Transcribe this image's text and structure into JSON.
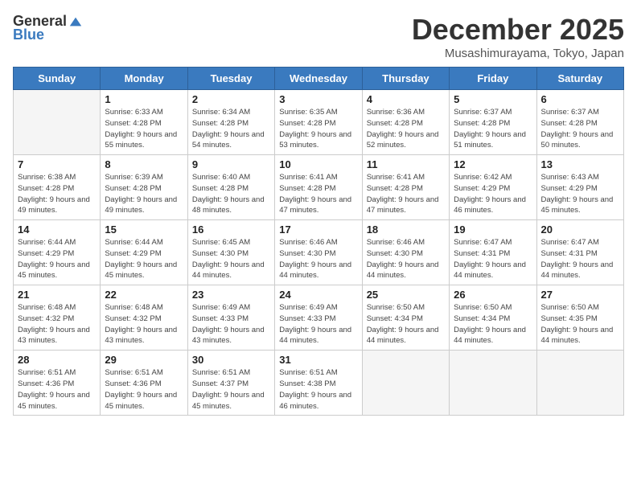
{
  "header": {
    "logo_general": "General",
    "logo_blue": "Blue",
    "title": "December 2025",
    "location": "Musashimurayama, Tokyo, Japan"
  },
  "weekdays": [
    "Sunday",
    "Monday",
    "Tuesday",
    "Wednesday",
    "Thursday",
    "Friday",
    "Saturday"
  ],
  "days": [
    {
      "date": "",
      "sunrise": "",
      "sunset": "",
      "daylight": ""
    },
    {
      "date": "1",
      "sunrise": "6:33 AM",
      "sunset": "4:28 PM",
      "daylight": "9 hours and 55 minutes."
    },
    {
      "date": "2",
      "sunrise": "6:34 AM",
      "sunset": "4:28 PM",
      "daylight": "9 hours and 54 minutes."
    },
    {
      "date": "3",
      "sunrise": "6:35 AM",
      "sunset": "4:28 PM",
      "daylight": "9 hours and 53 minutes."
    },
    {
      "date": "4",
      "sunrise": "6:36 AM",
      "sunset": "4:28 PM",
      "daylight": "9 hours and 52 minutes."
    },
    {
      "date": "5",
      "sunrise": "6:37 AM",
      "sunset": "4:28 PM",
      "daylight": "9 hours and 51 minutes."
    },
    {
      "date": "6",
      "sunrise": "6:37 AM",
      "sunset": "4:28 PM",
      "daylight": "9 hours and 50 minutes."
    },
    {
      "date": "7",
      "sunrise": "6:38 AM",
      "sunset": "4:28 PM",
      "daylight": "9 hours and 49 minutes."
    },
    {
      "date": "8",
      "sunrise": "6:39 AM",
      "sunset": "4:28 PM",
      "daylight": "9 hours and 49 minutes."
    },
    {
      "date": "9",
      "sunrise": "6:40 AM",
      "sunset": "4:28 PM",
      "daylight": "9 hours and 48 minutes."
    },
    {
      "date": "10",
      "sunrise": "6:41 AM",
      "sunset": "4:28 PM",
      "daylight": "9 hours and 47 minutes."
    },
    {
      "date": "11",
      "sunrise": "6:41 AM",
      "sunset": "4:28 PM",
      "daylight": "9 hours and 47 minutes."
    },
    {
      "date": "12",
      "sunrise": "6:42 AM",
      "sunset": "4:29 PM",
      "daylight": "9 hours and 46 minutes."
    },
    {
      "date": "13",
      "sunrise": "6:43 AM",
      "sunset": "4:29 PM",
      "daylight": "9 hours and 45 minutes."
    },
    {
      "date": "14",
      "sunrise": "6:44 AM",
      "sunset": "4:29 PM",
      "daylight": "9 hours and 45 minutes."
    },
    {
      "date": "15",
      "sunrise": "6:44 AM",
      "sunset": "4:29 PM",
      "daylight": "9 hours and 45 minutes."
    },
    {
      "date": "16",
      "sunrise": "6:45 AM",
      "sunset": "4:30 PM",
      "daylight": "9 hours and 44 minutes."
    },
    {
      "date": "17",
      "sunrise": "6:46 AM",
      "sunset": "4:30 PM",
      "daylight": "9 hours and 44 minutes."
    },
    {
      "date": "18",
      "sunrise": "6:46 AM",
      "sunset": "4:30 PM",
      "daylight": "9 hours and 44 minutes."
    },
    {
      "date": "19",
      "sunrise": "6:47 AM",
      "sunset": "4:31 PM",
      "daylight": "9 hours and 44 minutes."
    },
    {
      "date": "20",
      "sunrise": "6:47 AM",
      "sunset": "4:31 PM",
      "daylight": "9 hours and 44 minutes."
    },
    {
      "date": "21",
      "sunrise": "6:48 AM",
      "sunset": "4:32 PM",
      "daylight": "9 hours and 43 minutes."
    },
    {
      "date": "22",
      "sunrise": "6:48 AM",
      "sunset": "4:32 PM",
      "daylight": "9 hours and 43 minutes."
    },
    {
      "date": "23",
      "sunrise": "6:49 AM",
      "sunset": "4:33 PM",
      "daylight": "9 hours and 43 minutes."
    },
    {
      "date": "24",
      "sunrise": "6:49 AM",
      "sunset": "4:33 PM",
      "daylight": "9 hours and 44 minutes."
    },
    {
      "date": "25",
      "sunrise": "6:50 AM",
      "sunset": "4:34 PM",
      "daylight": "9 hours and 44 minutes."
    },
    {
      "date": "26",
      "sunrise": "6:50 AM",
      "sunset": "4:34 PM",
      "daylight": "9 hours and 44 minutes."
    },
    {
      "date": "27",
      "sunrise": "6:50 AM",
      "sunset": "4:35 PM",
      "daylight": "9 hours and 44 minutes."
    },
    {
      "date": "28",
      "sunrise": "6:51 AM",
      "sunset": "4:36 PM",
      "daylight": "9 hours and 45 minutes."
    },
    {
      "date": "29",
      "sunrise": "6:51 AM",
      "sunset": "4:36 PM",
      "daylight": "9 hours and 45 minutes."
    },
    {
      "date": "30",
      "sunrise": "6:51 AM",
      "sunset": "4:37 PM",
      "daylight": "9 hours and 45 minutes."
    },
    {
      "date": "31",
      "sunrise": "6:51 AM",
      "sunset": "4:38 PM",
      "daylight": "9 hours and 46 minutes."
    }
  ],
  "labels": {
    "sunrise": "Sunrise:",
    "sunset": "Sunset:",
    "daylight": "Daylight:"
  }
}
